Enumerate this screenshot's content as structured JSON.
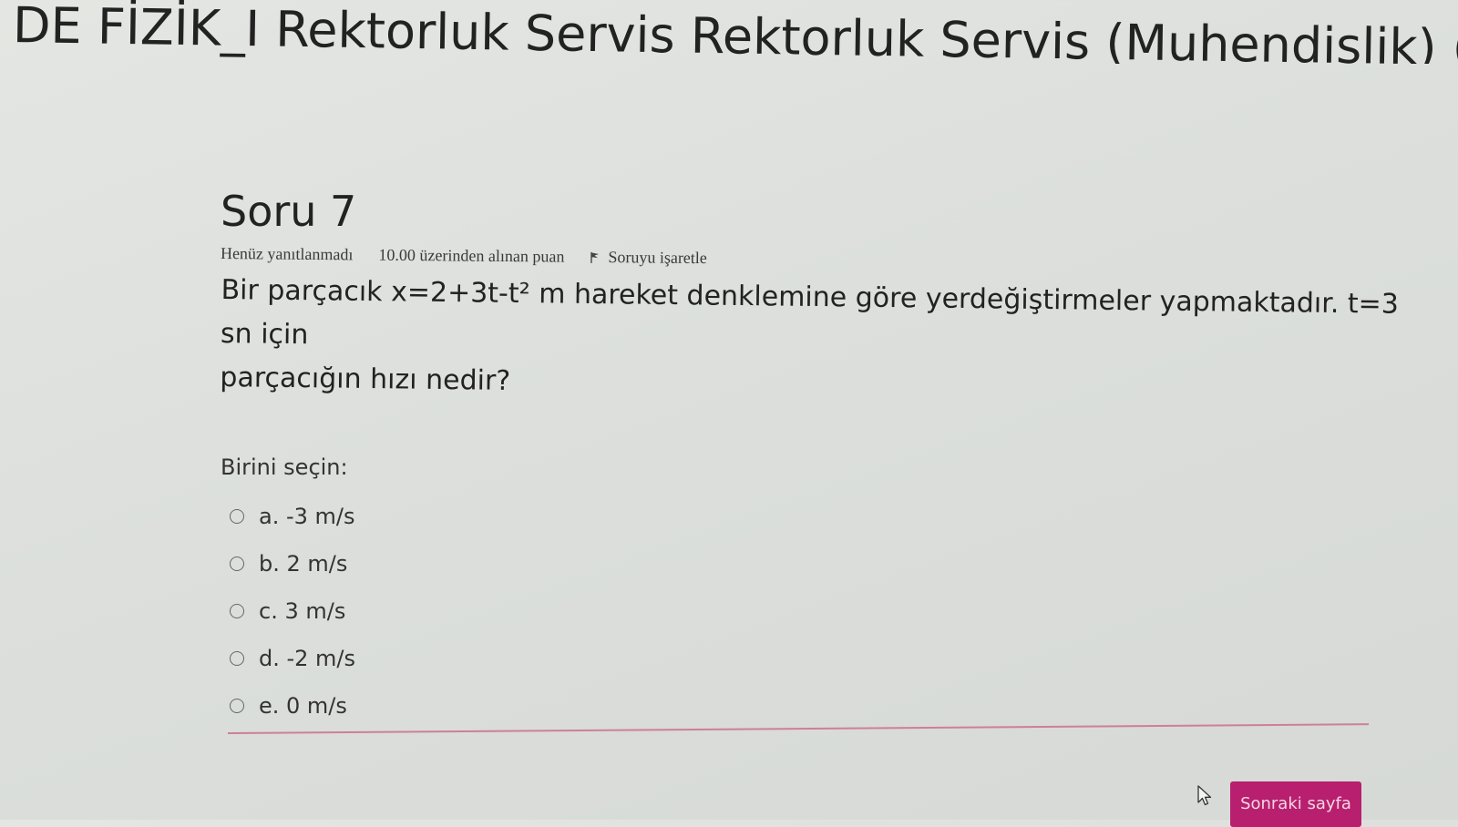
{
  "header": {
    "course_title": "DE FİZİK_I Rektorluk Servis Rektorluk Servis (Muhendislik) ("
  },
  "question": {
    "title": "Soru 7",
    "status": "Henüz yanıtlanmadı",
    "points": "10.00 üzerinden alınan puan",
    "flag_label": "Soruyu işaretle",
    "text_line1": "Bir parçacık x=2+3t-t² m hareket denklemine göre yerdeğiştirmeler yapmaktadır. t=3 sn için",
    "text_line2": "parçacığın hızı nedir?",
    "prompt": "Birini seçin:",
    "answers": [
      {
        "label": "a. -3 m/s",
        "selected": false
      },
      {
        "label": "b. 2 m/s",
        "selected": false
      },
      {
        "label": "c. 3 m/s",
        "selected": false
      },
      {
        "label": "d. -2 m/s",
        "selected": false
      },
      {
        "label": "e. 0 m/s",
        "selected": false
      }
    ]
  },
  "navigation": {
    "next_label": "Sonraki sayfa"
  },
  "colors": {
    "accent": "#b81f6e",
    "divider": "#cf7f96"
  }
}
